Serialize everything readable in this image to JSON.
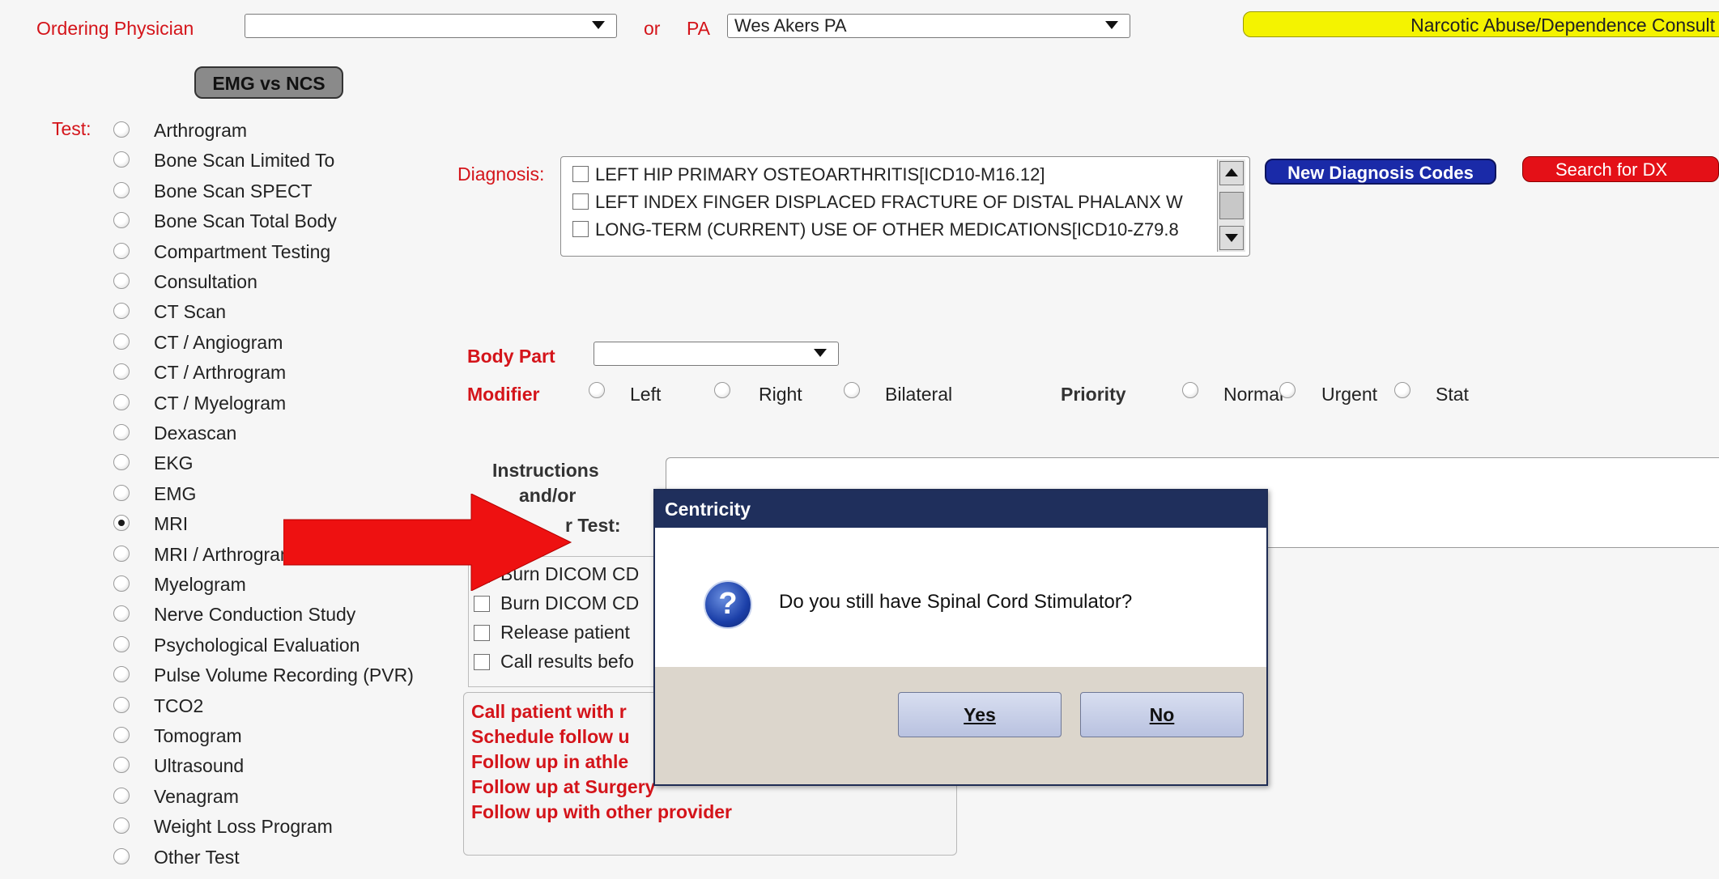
{
  "header": {
    "ordering_physician_label": "Ordering Physician",
    "ordering_physician_value": "",
    "or_label": "or",
    "pa_label": "PA",
    "pa_value": "Wes Akers PA",
    "consult_button": "Narcotic Abuse/Dependence Consult",
    "emg_vs_ncs_button": "EMG vs NCS"
  },
  "tests": {
    "label": "Test:",
    "selected": "MRI",
    "options": [
      "Arthrogram",
      "Bone Scan Limited To",
      "Bone Scan SPECT",
      "Bone Scan Total Body",
      "Compartment Testing",
      "Consultation",
      "CT Scan",
      "CT / Angiogram",
      "CT / Arthrogram",
      "CT / Myelogram",
      "Dexascan",
      "EKG",
      "EMG",
      "MRI",
      "MRI / Arthrogram",
      "Myelogram",
      "Nerve Conduction Study",
      "Psychological Evaluation",
      "Pulse Volume Recording (PVR)",
      "TCO2",
      "Tomogram",
      "Ultrasound",
      "Venagram",
      "Weight Loss Program",
      "Other Test"
    ]
  },
  "diagnosis": {
    "label": "Diagnosis:",
    "items": [
      "LEFT HIP PRIMARY OSTEOARTHRITIS[ICD10-M16.12]",
      "LEFT INDEX FINGER DISPLACED FRACTURE OF DISTAL PHALANX W",
      "LONG-TERM (CURRENT) USE OF OTHER MEDICATIONS[ICD10-Z79.8"
    ],
    "new_codes_button": "New Diagnosis Codes",
    "search_button": "Search for DX"
  },
  "body_part": {
    "label": "Body Part",
    "value": ""
  },
  "modifier": {
    "label": "Modifier",
    "options": [
      "Left",
      "Right",
      "Bilateral"
    ]
  },
  "priority": {
    "label": "Priority",
    "options": [
      "Normal",
      "Urgent",
      "Stat"
    ]
  },
  "instructions": {
    "line1": "Instructions",
    "line2": "and/or",
    "line3": "r Test:"
  },
  "checkbox_options": [
    "Burn DICOM CD",
    "Burn DICOM CD",
    "Release patient",
    "Call results befo"
  ],
  "followups": [
    "Call patient with r",
    "Schedule follow u",
    "Follow up in athle",
    "Follow up at Surgery",
    "Follow up with other provider"
  ],
  "dialog": {
    "title": "Centricity",
    "message": "Do you still have Spinal Cord Stimulator?",
    "yes_label": "Yes",
    "no_label": "No"
  },
  "colors": {
    "label_red": "#d4141a",
    "consult_yellow": "#f4f300",
    "new_codes_blue": "#1a2aa8",
    "search_red": "#e41017",
    "dialog_title": "#1f2f5c",
    "arrow_red": "#ee1111"
  }
}
